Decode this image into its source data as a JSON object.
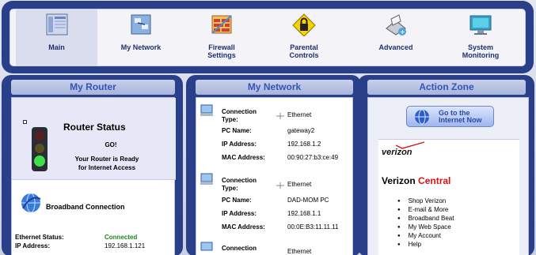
{
  "nav": {
    "items": [
      {
        "label_1": "Main",
        "label_2": "",
        "icon": "main-icon"
      },
      {
        "label_1": "My Network",
        "label_2": "",
        "icon": "network-icon"
      },
      {
        "label_1": "Firewall",
        "label_2": "Settings",
        "icon": "firewall-icon"
      },
      {
        "label_1": "Parental",
        "label_2": "Controls",
        "icon": "lock-icon"
      },
      {
        "label_1": "Advanced",
        "label_2": "",
        "icon": "advanced-icon"
      },
      {
        "label_1": "System",
        "label_2": "Monitoring",
        "icon": "monitor-icon"
      }
    ]
  },
  "router": {
    "title": "My Router",
    "status_title": "Router Status",
    "go": "GO!",
    "ready_1": "Your Router is Ready",
    "ready_2": "for Internet Access",
    "broadband": "Broadband Connection",
    "eth_status_label": "Ethernet Status:",
    "eth_status_value": "Connected",
    "ip_label": "IP Address:",
    "ip_value": "192.168.1.121"
  },
  "network": {
    "title": "My Network",
    "labels": {
      "conn_1": "Connection",
      "conn_2": "Type:",
      "pc": "PC Name:",
      "ip": "IP Address:",
      "mac": "MAC Address:"
    },
    "devices": [
      {
        "type": "Ethernet",
        "pc": "gateway2",
        "ip": "192.168.1.2",
        "mac": "00:90:27:b3:ce:49"
      },
      {
        "type": "Ethernet",
        "pc": "DAD-MOM PC",
        "ip": "192.168.1.1",
        "mac": "00:0E:B3:11.11.11"
      },
      {
        "type": "Ethernet"
      }
    ]
  },
  "action": {
    "title": "Action Zone",
    "go_1": "Go to the",
    "go_2": "Internet Now",
    "logo": "verizon",
    "central_1": "Verizon",
    "central_2": "Central",
    "links": [
      "Shop Verizon",
      "E-mail & More",
      "Broadband Beat",
      "My Web Space",
      "My Account",
      "Help"
    ]
  }
}
